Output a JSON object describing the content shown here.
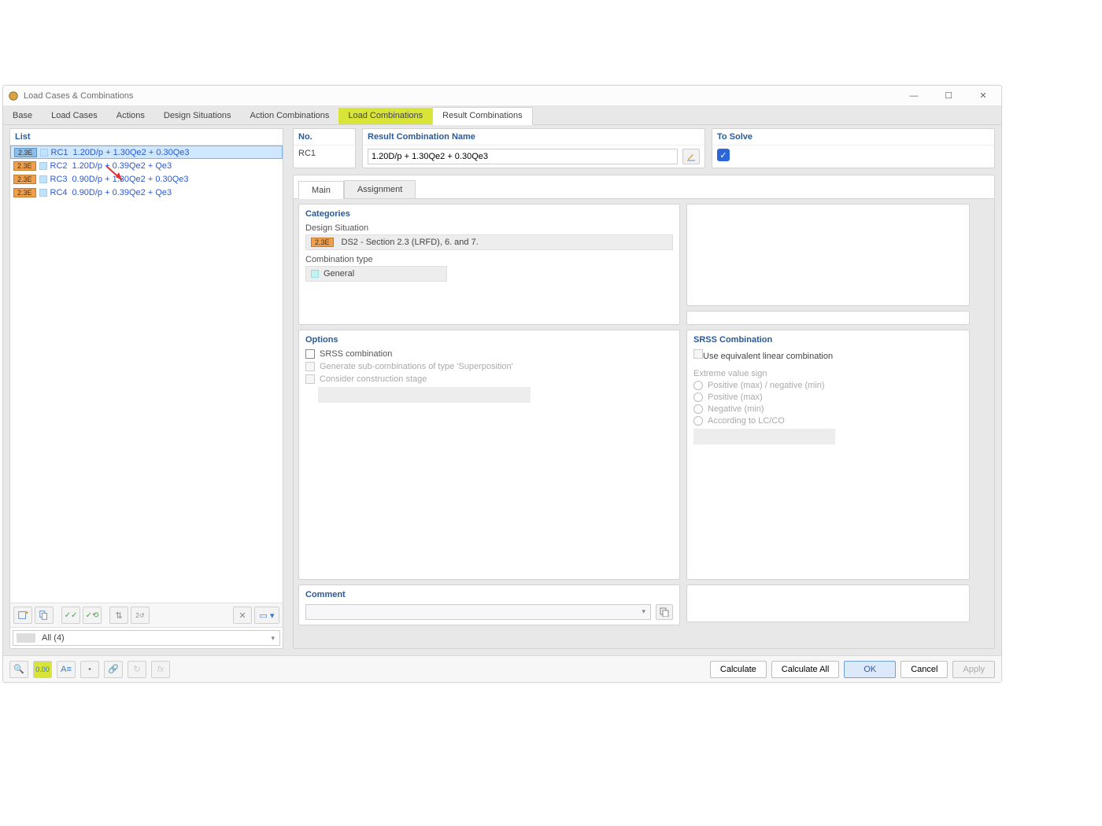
{
  "window": {
    "title": "Load Cases & Combinations"
  },
  "top_tabs": {
    "base": "Base",
    "load_cases": "Load Cases",
    "actions": "Actions",
    "design_sit": "Design Situations",
    "action_comb": "Action Combinations",
    "load_comb": "Load Combinations",
    "result_comb": "Result Combinations"
  },
  "list": {
    "header": "List",
    "rows": [
      {
        "badge": "2.3E",
        "id": "RC1",
        "name": "1.20D/p + 1.30Qe2 + 0.30Qe3"
      },
      {
        "badge": "2.3E",
        "id": "RC2",
        "name": "1.20D/p + 0.39Qe2 + Qe3"
      },
      {
        "badge": "2.3E",
        "id": "RC3",
        "name": "0.90D/p + 1.30Qe2 + 0.30Qe3"
      },
      {
        "badge": "2.3E",
        "id": "RC4",
        "name": "0.90D/p + 0.39Qe2 + Qe3"
      }
    ],
    "filter": "All (4)"
  },
  "fields": {
    "no_label": "No.",
    "no_value": "RC1",
    "name_label": "Result Combination Name",
    "name_value": "1.20D/p + 1.30Qe2 + 0.30Qe3",
    "solve_label": "To Solve"
  },
  "sub_tabs": {
    "main": "Main",
    "assign": "Assignment"
  },
  "categories": {
    "title": "Categories",
    "design_sit_label": "Design Situation",
    "design_sit_badge": "2.3E",
    "design_sit_value": "DS2 - Section 2.3 (LRFD), 6. and 7.",
    "comb_type_label": "Combination type",
    "comb_type_value": "General"
  },
  "options": {
    "title": "Options",
    "srss": "SRSS combination",
    "gen_sub": "Generate sub-combinations of type 'Superposition'",
    "cons_stage": "Consider construction stage"
  },
  "srss": {
    "title": "SRSS Combination",
    "use_eq": "Use equivalent linear combination",
    "evs_label": "Extreme value sign",
    "r1": "Positive (max) / negative (min)",
    "r2": "Positive (max)",
    "r3": "Negative (min)",
    "r4": "According to LC/CO"
  },
  "comment": {
    "title": "Comment"
  },
  "footer": {
    "calc": "Calculate",
    "calc_all": "Calculate All",
    "ok": "OK",
    "cancel": "Cancel",
    "apply": "Apply"
  }
}
